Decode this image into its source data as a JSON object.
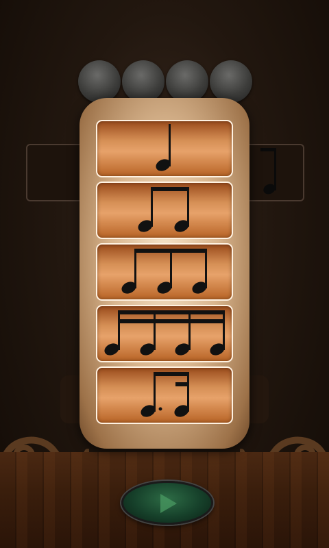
{
  "background": {
    "pegs": [
      "tuning-peg",
      "tuning-peg",
      "tuning-peg",
      "tuning-peg"
    ]
  },
  "rhythm_menu": {
    "options": [
      {
        "id": "quarter-note",
        "icon": "quarter-note-icon"
      },
      {
        "id": "two-eighth-notes",
        "icon": "two-eighth-notes-icon"
      },
      {
        "id": "eighth-note-triplet",
        "icon": "triplet-icon"
      },
      {
        "id": "four-sixteenth-notes",
        "icon": "four-sixteenth-notes-icon"
      },
      {
        "id": "dotted-eighth-sixteenth",
        "icon": "dotted-eighth-sixteenth-icon"
      }
    ]
  },
  "controls": {
    "play": {
      "icon": "play-icon",
      "color": "#2d6b45"
    }
  },
  "colors": {
    "panel": "#d9b68f",
    "option_fill": "#d58f55",
    "option_border": "#fff2e2",
    "note_ink": "#111111"
  }
}
